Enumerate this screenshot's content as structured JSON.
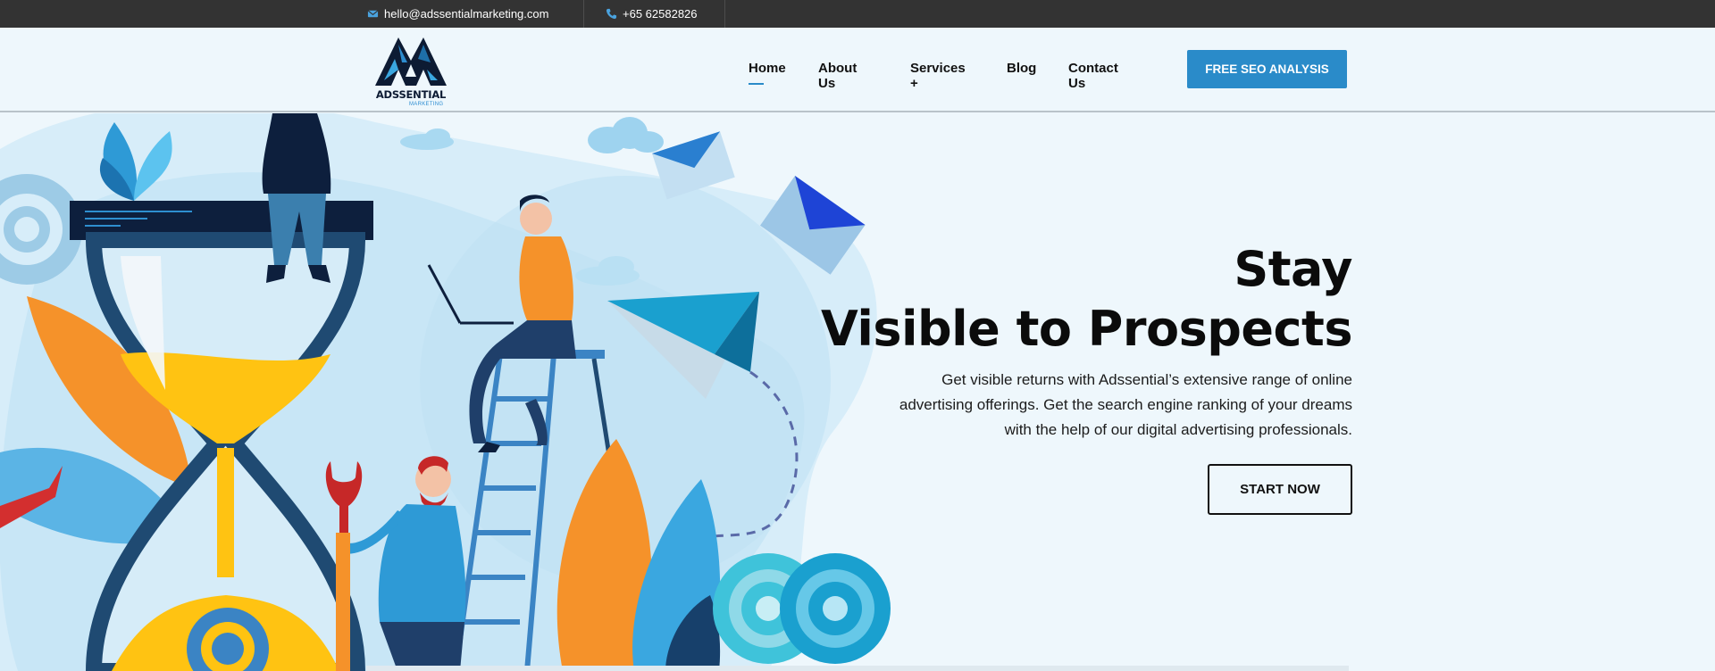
{
  "topbar": {
    "email": "hello@adssentialmarketing.com",
    "phone": "+65 62582826",
    "email_icon": "envelope-icon",
    "phone_icon": "phone-icon"
  },
  "logo": {
    "name": "ADSSENTIAL",
    "sub": "MARKETING"
  },
  "nav": {
    "items": [
      {
        "label": "Home",
        "active": true
      },
      {
        "label": "About Us"
      },
      {
        "label": "Services +"
      },
      {
        "label": "Blog"
      },
      {
        "label": "Contact Us"
      }
    ],
    "cta": "FREE SEO ANALYSIS"
  },
  "hero": {
    "title_line1": "Stay",
    "title_line2": "Visible to Prospects",
    "description_lines": [
      "Get visible returns with Adssential’s extensive range of online",
      "advertising offerings. Get the search engine ranking of your dreams",
      "with the help of our digital advertising professionals."
    ],
    "button": "START NOW"
  },
  "colors": {
    "accent": "#2a8bc9",
    "topbar": "#333333",
    "background": "#eef7fc"
  }
}
